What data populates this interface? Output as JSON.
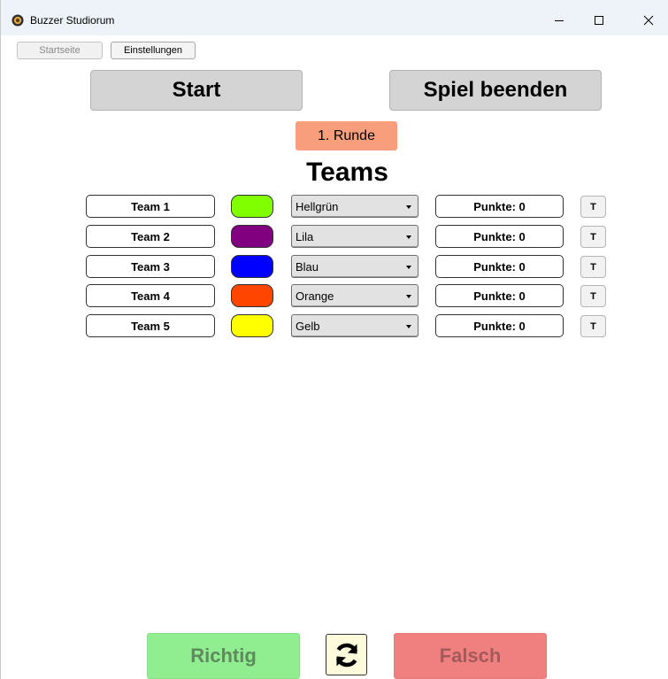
{
  "window": {
    "title": "Buzzer Studiorum",
    "controls": [
      "minimize-icon",
      "maximize-icon",
      "close-icon"
    ]
  },
  "menu": {
    "startseite": "Startseite",
    "einstellungen": "Einstellungen"
  },
  "controls": {
    "start": "Start",
    "end_game": "Spiel beenden",
    "round": "1. Runde"
  },
  "teams_heading": "Teams",
  "teams": [
    {
      "name": "Team 1",
      "color_name": "Hellgrün",
      "color": "#80ff00",
      "points": "Punkte: 0",
      "t_label": "T"
    },
    {
      "name": "Team 2",
      "color_name": "Lila",
      "color": "#800080",
      "points": "Punkte: 0",
      "t_label": "T"
    },
    {
      "name": "Team 3",
      "color_name": "Blau",
      "color": "#0000ff",
      "points": "Punkte: 0",
      "t_label": "T"
    },
    {
      "name": "Team 4",
      "color_name": "Orange",
      "color": "#ff4500",
      "points": "Punkte: 0",
      "t_label": "T"
    },
    {
      "name": "Team 5",
      "color_name": "Gelb",
      "color": "#ffff00",
      "points": "Punkte: 0",
      "t_label": "T"
    }
  ],
  "answer": {
    "correct": "Richtig",
    "wrong": "Falsch",
    "refresh_icon": "refresh-icon"
  },
  "colors": {
    "correct": "#90ee90",
    "wrong": "#f08080",
    "round_badge": "#f89e7d",
    "refresh_bg": "#fdfbdc"
  }
}
